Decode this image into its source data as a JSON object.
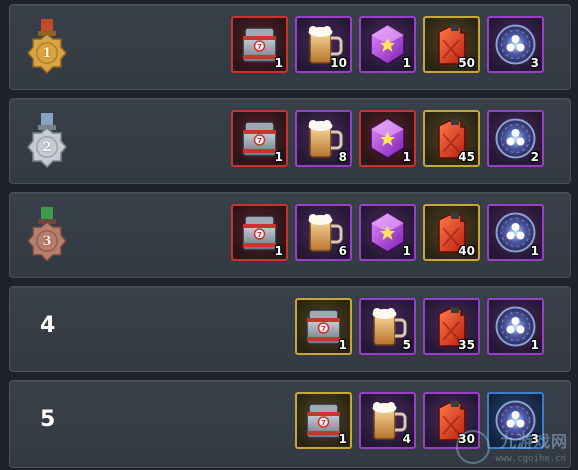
{
  "colors": {
    "row_bg": "#383e46",
    "slot_red": "#c9332b",
    "slot_purple": "#9a3fc7",
    "slot_gold": "#c8a637",
    "slot_blue": "#3c7ccf",
    "medal_gold": "#d9a441",
    "medal_silver": "#c7ccd3",
    "medal_bronze": "#b87e6e"
  },
  "rows": [
    {
      "rank_label": "1",
      "medal_icon": "gold-medal-icon",
      "rewards": [
        {
          "icon": "supply-chest-icon",
          "rarity": "red",
          "qty": "1"
        },
        {
          "icon": "beer-mug-icon",
          "rarity": "purple",
          "qty": "10"
        },
        {
          "icon": "purple-gem-icon",
          "rarity": "purple",
          "qty": "1"
        },
        {
          "icon": "fuel-can-icon",
          "rarity": "gold",
          "qty": "50"
        },
        {
          "icon": "blue-orb-icon",
          "rarity": "purple",
          "qty": "3"
        }
      ]
    },
    {
      "rank_label": "2",
      "medal_icon": "silver-medal-icon",
      "rewards": [
        {
          "icon": "supply-chest-icon",
          "rarity": "red",
          "qty": "1"
        },
        {
          "icon": "beer-mug-icon",
          "rarity": "purple",
          "qty": "8"
        },
        {
          "icon": "purple-gem-icon",
          "rarity": "red",
          "qty": "1"
        },
        {
          "icon": "fuel-can-icon",
          "rarity": "gold",
          "qty": "45"
        },
        {
          "icon": "blue-orb-icon",
          "rarity": "purple",
          "qty": "2"
        }
      ]
    },
    {
      "rank_label": "3",
      "medal_icon": "bronze-medal-icon",
      "rewards": [
        {
          "icon": "supply-chest-icon",
          "rarity": "red",
          "qty": "1"
        },
        {
          "icon": "beer-mug-icon",
          "rarity": "purple",
          "qty": "6"
        },
        {
          "icon": "purple-gem-icon",
          "rarity": "purple",
          "qty": "1"
        },
        {
          "icon": "fuel-can-icon",
          "rarity": "gold",
          "qty": "40"
        },
        {
          "icon": "blue-orb-icon",
          "rarity": "purple",
          "qty": "1"
        }
      ]
    },
    {
      "rank_label": "4",
      "medal_icon": null,
      "rewards": [
        {
          "icon": "supply-chest-icon",
          "rarity": "gold",
          "qty": "1"
        },
        {
          "icon": "beer-mug-icon",
          "rarity": "purple",
          "qty": "5"
        },
        {
          "icon": "fuel-can-icon",
          "rarity": "purple",
          "qty": "35"
        },
        {
          "icon": "blue-orb-icon",
          "rarity": "purple",
          "qty": "1"
        }
      ]
    },
    {
      "rank_label": "5",
      "medal_icon": null,
      "rewards": [
        {
          "icon": "supply-chest-icon",
          "rarity": "gold",
          "qty": "1"
        },
        {
          "icon": "beer-mug-icon",
          "rarity": "purple",
          "qty": "4"
        },
        {
          "icon": "fuel-can-icon",
          "rarity": "purple",
          "qty": "30"
        },
        {
          "icon": "blue-orb-icon",
          "rarity": "blue",
          "qty": "3"
        }
      ]
    }
  ],
  "watermark": {
    "title": "九游戏网",
    "url": "www.cgoihe.cn"
  }
}
